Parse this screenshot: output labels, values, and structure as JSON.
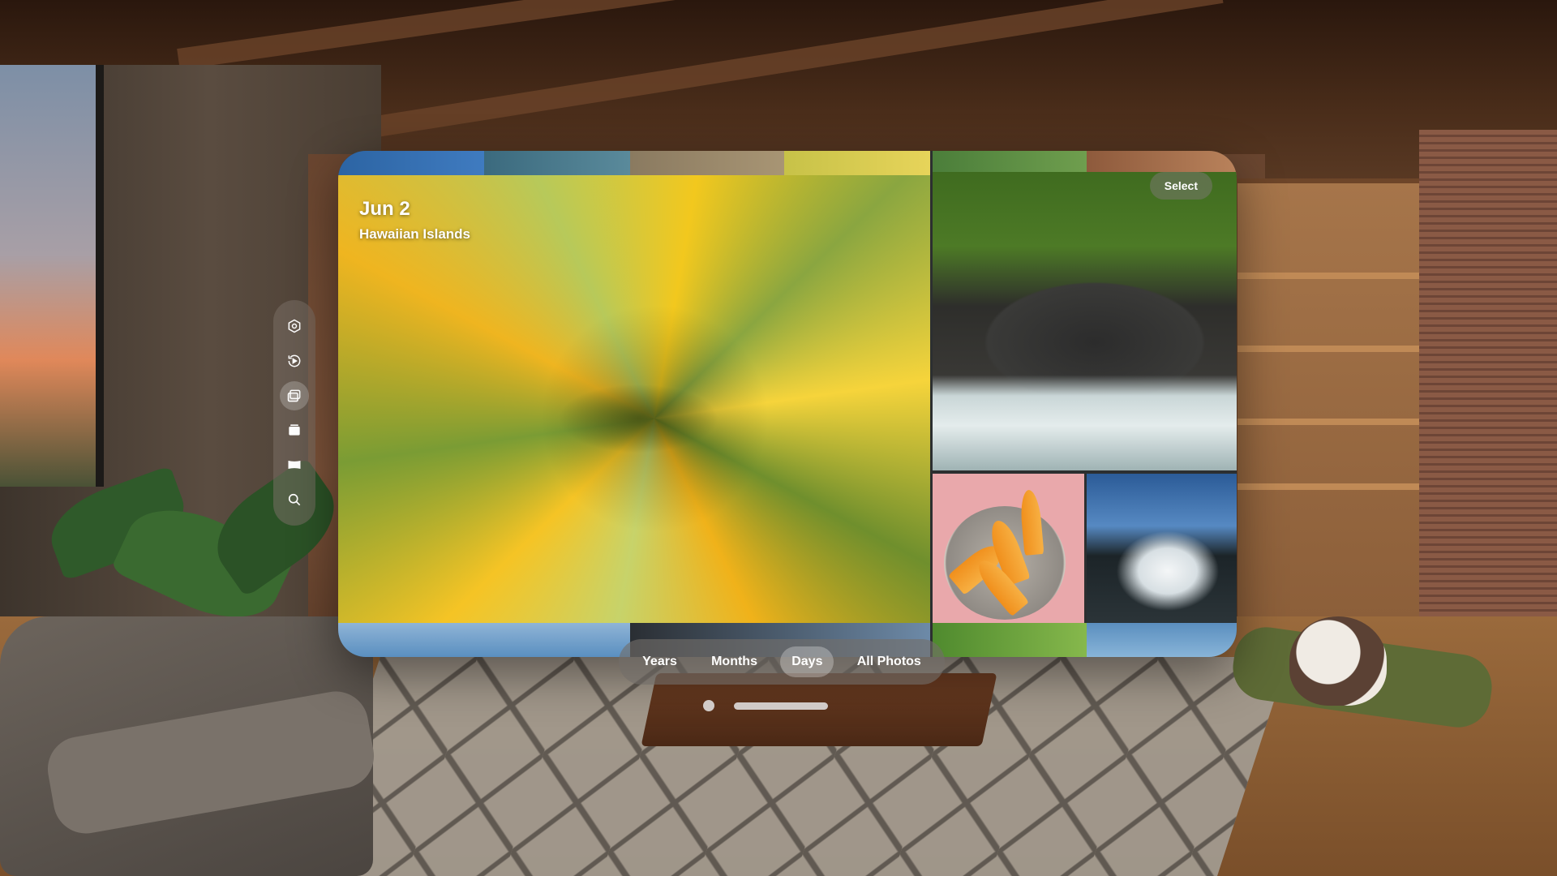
{
  "header": {
    "date": "Jun 2",
    "location": "Hawaiian Islands"
  },
  "toolbar": {
    "select_label": "Select"
  },
  "sidebar": {
    "items": [
      {
        "icon": "apps-icon",
        "active": false
      },
      {
        "icon": "memories-icon",
        "active": false
      },
      {
        "icon": "library-icon",
        "active": true
      },
      {
        "icon": "albums-icon",
        "active": false
      },
      {
        "icon": "panorama-icon",
        "active": false
      },
      {
        "icon": "search-icon",
        "active": false
      }
    ]
  },
  "view_switcher": {
    "options": [
      "Years",
      "Months",
      "Days",
      "All Photos"
    ],
    "selected": "Days"
  },
  "colors": {
    "glass": "#73706a",
    "accent": "#ffffff"
  }
}
